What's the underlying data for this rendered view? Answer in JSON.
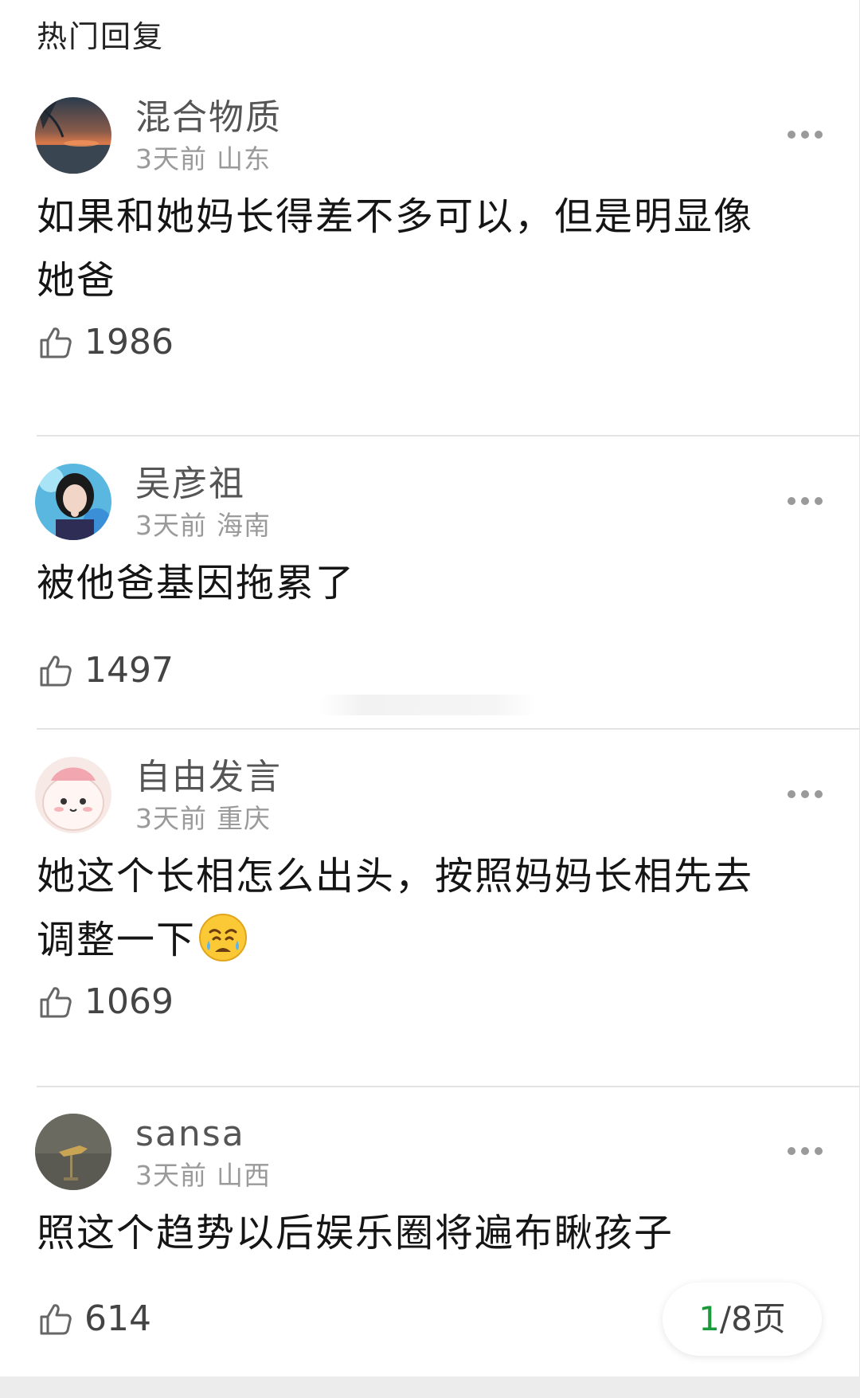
{
  "section_title": "热门回复",
  "comments": [
    {
      "user": "混合物质",
      "time": "3天前",
      "location": "山东",
      "text_lines": [
        "如果和她妈长得差不多可以，但是明显像",
        "她爸"
      ],
      "likes": "1986"
    },
    {
      "user": "吴彦祖",
      "time": "3天前",
      "location": "海南",
      "text_lines": [
        "被他爸基因拖累了"
      ],
      "likes": "1497"
    },
    {
      "user": "自由发言",
      "time": "3天前",
      "location": "重庆",
      "text_lines": [
        "她这个长相怎么出头，按照妈妈长相先去",
        "调整一下"
      ],
      "emoji": "weary-face-emoji",
      "likes": "1069"
    },
    {
      "user": "sansa",
      "time": "3天前",
      "location": "山西",
      "text_lines": [
        "照这个趋势以后娱乐圈将遍布瞅孩子"
      ],
      "likes": "614"
    }
  ],
  "pager": {
    "current": "1",
    "separator": "/",
    "total": "8页"
  },
  "icons": {
    "like": "thumbs-up-icon",
    "more": "more-dots-icon"
  },
  "colors": {
    "accent": "#1a9a3a",
    "meta": "#9a9a9a",
    "divider": "#e3e3e3"
  }
}
